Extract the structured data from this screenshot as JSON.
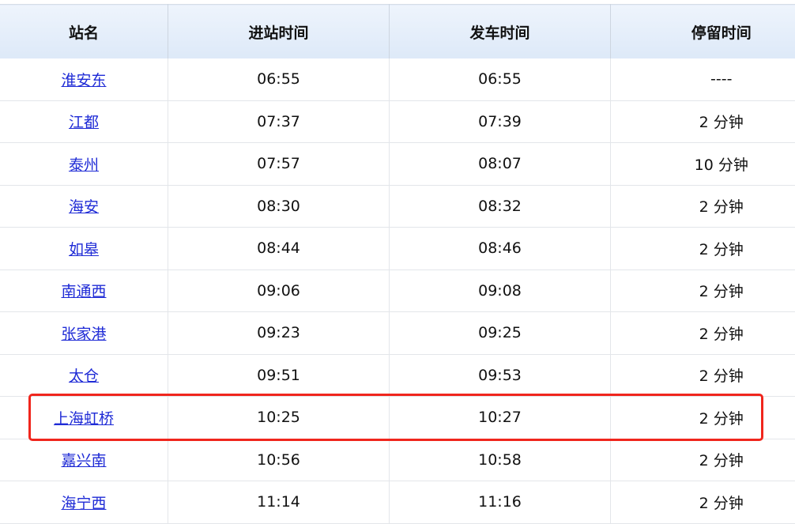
{
  "headers": [
    "站名",
    "进站时间",
    "发车时间",
    "停留时间"
  ],
  "rows": [
    {
      "station": "淮安东",
      "arrive": "06:55",
      "depart": "06:55",
      "stop": "----"
    },
    {
      "station": "江都",
      "arrive": "07:37",
      "depart": "07:39",
      "stop": "2 分钟"
    },
    {
      "station": "泰州",
      "arrive": "07:57",
      "depart": "08:07",
      "stop": "10 分钟"
    },
    {
      "station": "海安",
      "arrive": "08:30",
      "depart": "08:32",
      "stop": "2 分钟"
    },
    {
      "station": "如皋",
      "arrive": "08:44",
      "depart": "08:46",
      "stop": "2 分钟"
    },
    {
      "station": "南通西",
      "arrive": "09:06",
      "depart": "09:08",
      "stop": "2 分钟"
    },
    {
      "station": "张家港",
      "arrive": "09:23",
      "depart": "09:25",
      "stop": "2 分钟"
    },
    {
      "station": "太仓",
      "arrive": "09:51",
      "depart": "09:53",
      "stop": "2 分钟"
    },
    {
      "station": "上海虹桥",
      "arrive": "10:25",
      "depart": "10:27",
      "stop": "2 分钟"
    },
    {
      "station": "嘉兴南",
      "arrive": "10:56",
      "depart": "10:58",
      "stop": "2 分钟"
    },
    {
      "station": "海宁西",
      "arrive": "11:14",
      "depart": "11:16",
      "stop": "2 分钟"
    }
  ],
  "highlight_color": "#f0261d"
}
